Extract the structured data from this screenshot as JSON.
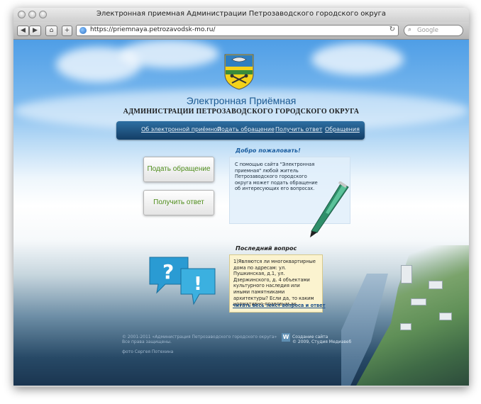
{
  "window": {
    "title": "Электронная приемная Администрации Петрозаводского городского округа"
  },
  "toolbar": {
    "back_label": "◀",
    "forward_label": "▶",
    "home_label": "⌂",
    "add_label": "+",
    "url": "https://priemnaya.petrozavodsk-mo.ru/",
    "reload_label": "↻",
    "search_placeholder": "Google"
  },
  "header": {
    "title": "Электронная Приёмная",
    "subtitle": "АДМИНИСТРАЦИИ ПЕТРОЗАВОДСКОГО ГОРОДСКОГО ОКРУГА"
  },
  "nav": {
    "items": [
      "Об электронной приёмной",
      "Подать обращение",
      "Получить ответ",
      "Обращения"
    ]
  },
  "actions": {
    "submit_label": "Подать обращение",
    "get_answer_label": "Получить ответ"
  },
  "welcome": {
    "heading": "Добро пожаловать!",
    "text": "С помощью сайта \"Электронная приемная\" любой житель Петрозаводского городского округа может подать обращение об интересующих его вопросах."
  },
  "last_question": {
    "heading": "Последний вопрос",
    "text": "1)Являются ли многоквартирные дома по адресам: ул. Пушкинская, д.1, ул. Дзержинского, д. 4 объектами культурного наследия или иными памятниками архитектуры? Если да, то каким нормативно-правовым ак...",
    "link": "читать весь текст вопроса и ответ"
  },
  "footer": {
    "copyright": "© 2001-2011 «Администрация Петрозаводского городского округа»",
    "rights": "Все права защищены.",
    "photo": "фото Сергея Потехина",
    "dev_logo": "W",
    "dev_line1": "Создание сайта",
    "dev_line2": "© 2009, Студия Медиавеб"
  },
  "colors": {
    "nav_bg": "#1f5585",
    "accent_green": "#4f8d1c",
    "link_blue": "#1a4f8a"
  }
}
